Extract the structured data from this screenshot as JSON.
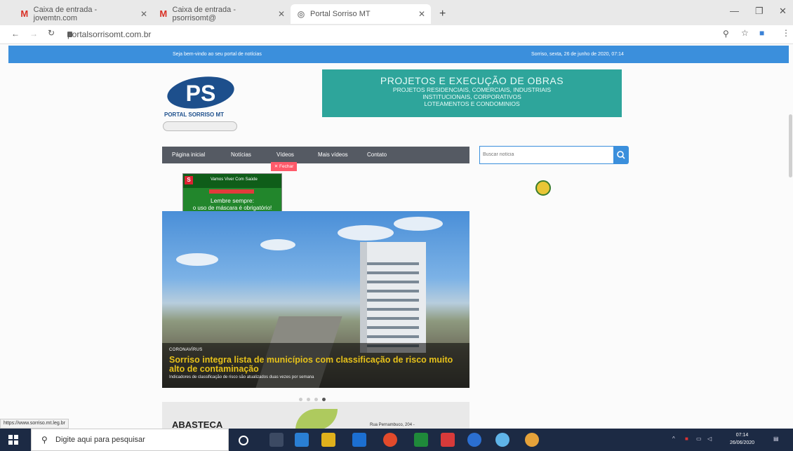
{
  "browser": {
    "tabs": [
      {
        "label": "Caixa de entrada - jovemtn.com",
        "icon": "gmail-icon"
      },
      {
        "label": "Caixa de entrada - psorrisomt@",
        "icon": "gmail-icon"
      },
      {
        "label": "Portal Sorriso MT",
        "icon": "globe-icon"
      }
    ],
    "url": "portalsorrisomt.com.br",
    "status_url": "https://www.sorriso.mt.leg.br"
  },
  "site": {
    "topbar_left": "Seja bem-vindo ao seu portal de notícias",
    "topbar_right": "Sorriso, sexta, 26 de junho de 2020, 07:14",
    "logo_letters": "PS",
    "logo_name": "PORTAL SORRISO MT",
    "banner": {
      "title": "PROJETOS E EXECUÇÃO DE OBRAS",
      "lines": [
        "PROJETOS RESIDENCIAIS, COMERCIAIS, INDUSTRIAIS",
        "INSTITUCIONAIS, CORPORATIVOS",
        "LOTEAMENTOS E CONDOMINIOS"
      ]
    },
    "nav": [
      "Página inicial",
      "Notícias",
      "Vídeos",
      "Mais vídeos",
      "Contato"
    ],
    "search_placeholder": "Buscar notícia",
    "popup": {
      "close_label": "✕ Fechar",
      "badge": "S",
      "header": "Vamos Viver Com Saúde",
      "line1": "Lembre sempre:",
      "line2": "o uso de máscara é obrigatório!"
    },
    "hero": {
      "category": "CORONAVÍRUS",
      "headline": "Sorriso integra lista de municípios com classificação de risco muito alto de contaminação",
      "sub": "Indicadores de classificação de risco são atualizados duas vezes por semana"
    },
    "ad2": {
      "title": "ABASTECA",
      "small": "Rua Pernambuco, 204 -"
    }
  },
  "taskbar": {
    "search_placeholder": "Digite aqui para pesquisar",
    "time": "07:14",
    "date": "26/06/2020"
  }
}
